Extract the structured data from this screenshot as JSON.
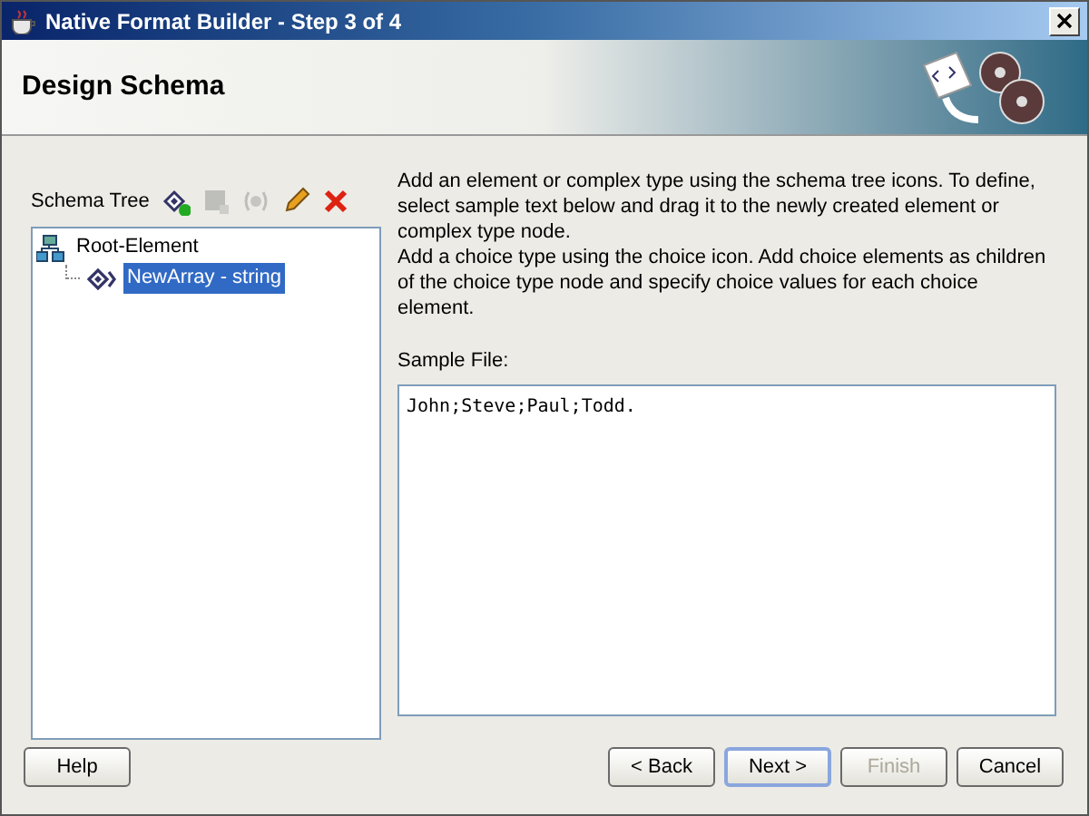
{
  "window": {
    "title": "Native Format Builder - Step 3 of 4"
  },
  "header": {
    "title": "Design Schema"
  },
  "schema_tree": {
    "label": "Schema Tree",
    "tools": [
      {
        "kind": "add",
        "disabled": false
      },
      {
        "kind": "box",
        "disabled": true
      },
      {
        "kind": "choice",
        "disabled": true
      },
      {
        "kind": "edit",
        "disabled": false
      },
      {
        "kind": "delete",
        "disabled": false
      }
    ],
    "nodes": [
      {
        "label": "Root-Element",
        "kind": "root",
        "selected": false,
        "children": [
          {
            "label": "NewArray - string",
            "kind": "element",
            "selected": true
          }
        ]
      }
    ]
  },
  "instructions": [
    "Add an element or complex type using the schema tree icons. To define, select sample text below and drag it to the newly created element or complex type node.",
    "Add a choice type using the choice icon. Add choice elements as children of the choice type node and specify choice values for each choice element."
  ],
  "sample_file": {
    "label": "Sample File:",
    "value": "John;Steve;Paul;Todd."
  },
  "help_button": {
    "label": "Help",
    "disabled": false,
    "default": false
  },
  "buttons": [
    {
      "label": "< Back",
      "disabled": false,
      "default": false
    },
    {
      "label": "Next >",
      "disabled": false,
      "default": true
    },
    {
      "label": "Finish",
      "disabled": true,
      "default": false
    },
    {
      "label": "Cancel",
      "disabled": false,
      "default": false
    }
  ]
}
